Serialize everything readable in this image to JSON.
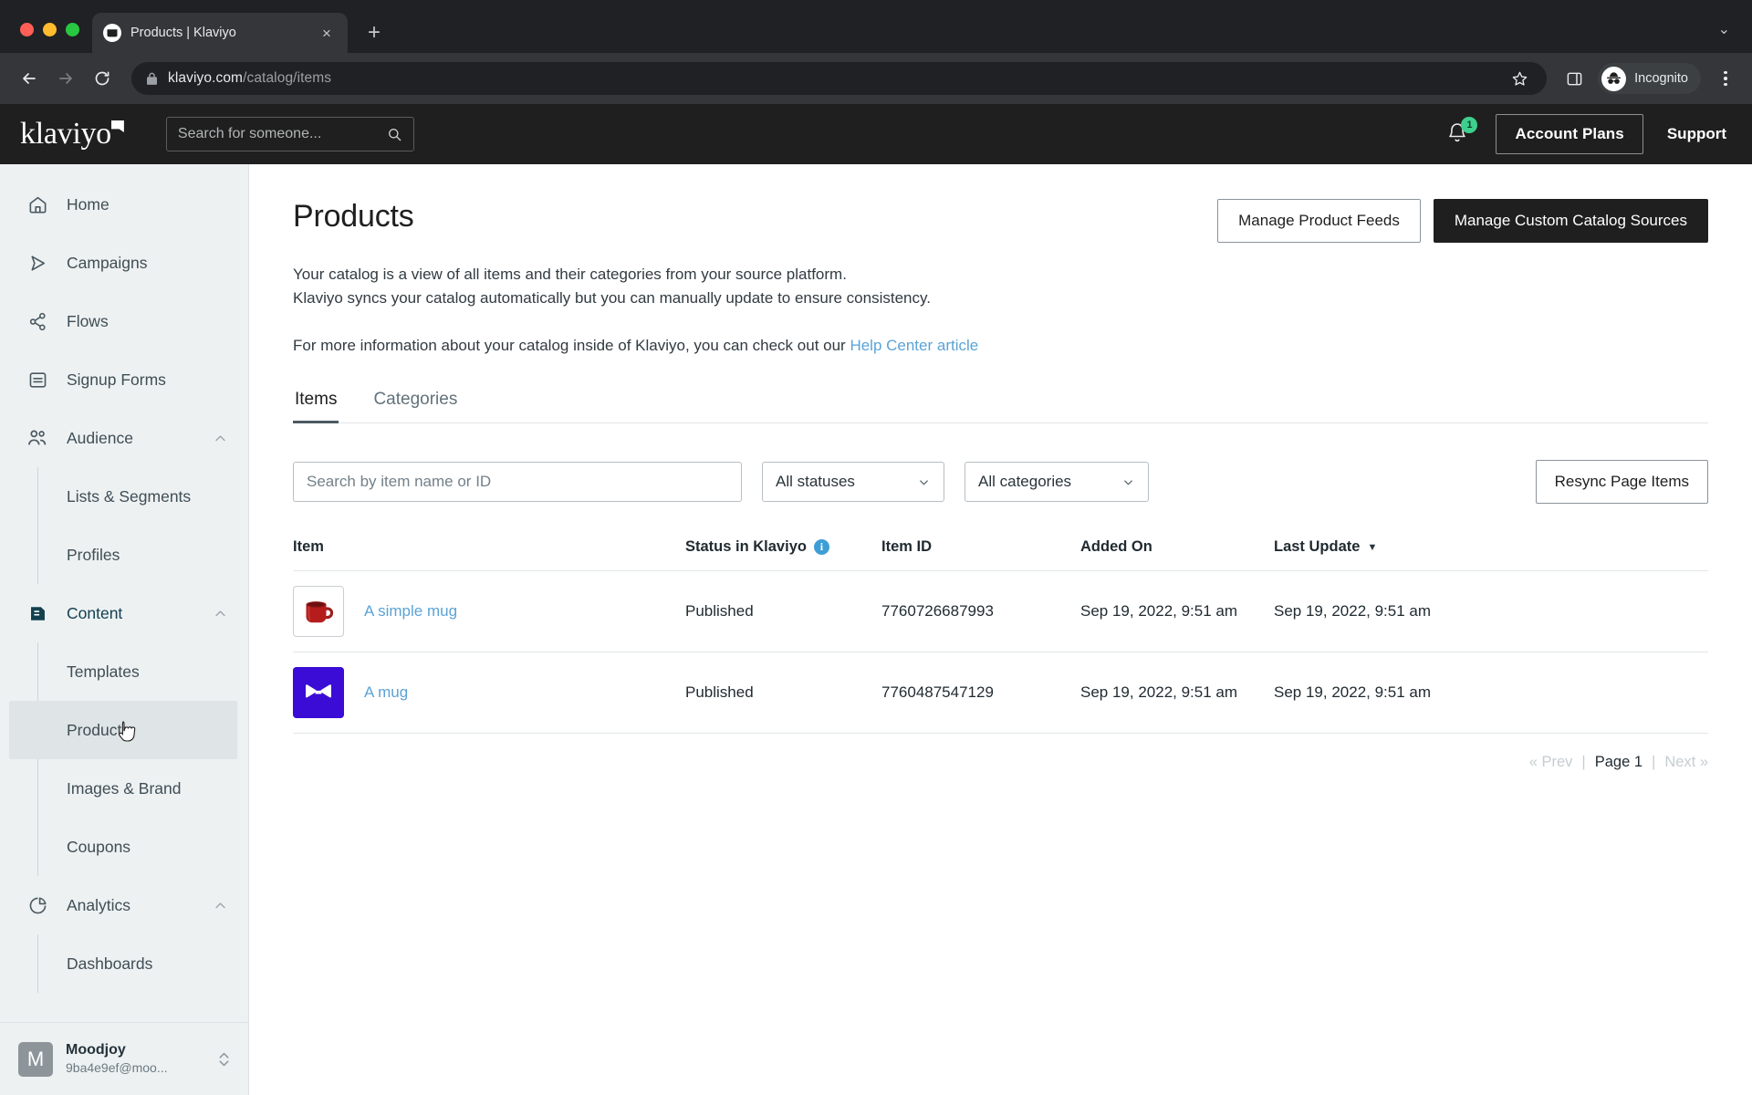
{
  "browser": {
    "tab": {
      "title": "Products | Klaviyo",
      "favicon_name": "klaviyo-favicon",
      "close_label": "×"
    },
    "new_tab_label": "+",
    "tabstrip_chevron": "⌄",
    "back_label": "←",
    "forward_label": "→",
    "reload_label": "↻",
    "url_domain": "klaviyo.com",
    "url_path": "/catalog/items",
    "bookmark_label": "☆",
    "profile_label": "Incognito"
  },
  "appbar": {
    "logo_text": "klaviyo",
    "search_placeholder": "Search for someone...",
    "search_value": "",
    "notification_count": "1",
    "account_plans_label": "Account Plans",
    "support_label": "Support"
  },
  "sidebar": {
    "items": [
      {
        "label": "Home",
        "icon": "home-icon",
        "type": "nav"
      },
      {
        "label": "Campaigns",
        "icon": "send-icon",
        "type": "nav"
      },
      {
        "label": "Flows",
        "icon": "flows-icon",
        "type": "nav"
      },
      {
        "label": "Signup Forms",
        "icon": "form-icon",
        "type": "nav"
      },
      {
        "label": "Audience",
        "icon": "people-icon",
        "type": "group",
        "expanded": true
      },
      {
        "label": "Lists & Segments",
        "type": "sub"
      },
      {
        "label": "Profiles",
        "type": "sub"
      },
      {
        "label": "Content",
        "icon": "content-icon",
        "type": "group",
        "expanded": true,
        "active": true
      },
      {
        "label": "Templates",
        "type": "sub"
      },
      {
        "label": "Products",
        "type": "sub",
        "hovered": true
      },
      {
        "label": "Images & Brand",
        "type": "sub"
      },
      {
        "label": "Coupons",
        "type": "sub"
      },
      {
        "label": "Analytics",
        "icon": "analytics-icon",
        "type": "group",
        "expanded": true
      },
      {
        "label": "Dashboards",
        "type": "sub"
      }
    ],
    "account": {
      "avatar_initial": "M",
      "name": "Moodjoy",
      "email": "9ba4e9ef@moo..."
    }
  },
  "page": {
    "title": "Products",
    "actions": {
      "manage_feeds": "Manage Product Feeds",
      "manage_sources": "Manage Custom Catalog Sources"
    },
    "intro_line1": "Your catalog is a view of all items and their categories from your source platform.",
    "intro_line2": "Klaviyo syncs your catalog automatically but you can manually update to ensure consistency.",
    "intro_line3_prefix": "For more information about your catalog inside of Klaviyo, you can check out our ",
    "intro_link": "Help Center article",
    "tabs": [
      {
        "label": "Items",
        "active": true
      },
      {
        "label": "Categories",
        "active": false
      }
    ],
    "filters": {
      "search_placeholder": "Search by item name or ID",
      "search_value": "",
      "status_selected": "All statuses",
      "category_selected": "All categories",
      "resync_label": "Resync Page Items"
    },
    "table": {
      "columns": [
        {
          "label": "Item"
        },
        {
          "label": "Status in Klaviyo",
          "info": true
        },
        {
          "label": "Item ID"
        },
        {
          "label": "Added On"
        },
        {
          "label": "Last Update",
          "sorted": true,
          "sort_dir": "desc"
        }
      ],
      "rows": [
        {
          "name": "A simple mug",
          "thumb": "red-mug-photo",
          "status": "Published",
          "item_id": "7760726687993",
          "added_on": "Sep 19, 2022, 9:51 am",
          "last_update": "Sep 19, 2022, 9:51 am"
        },
        {
          "name": "A mug",
          "thumb": "blue-butterfly-logo",
          "status": "Published",
          "item_id": "7760487547129",
          "added_on": "Sep 19, 2022, 9:51 am",
          "last_update": "Sep 19, 2022, 9:51 am"
        }
      ]
    },
    "pagination": {
      "prev": "« Prev",
      "sep": "|",
      "current": "Page 1",
      "next": "Next »"
    }
  },
  "colors": {
    "accent_link": "#5ba3d6",
    "badge_green": "#3ecf8e",
    "active_nav": "#12404f",
    "info_blue": "#3d9ed6",
    "dark_button": "#1f1f1f"
  }
}
